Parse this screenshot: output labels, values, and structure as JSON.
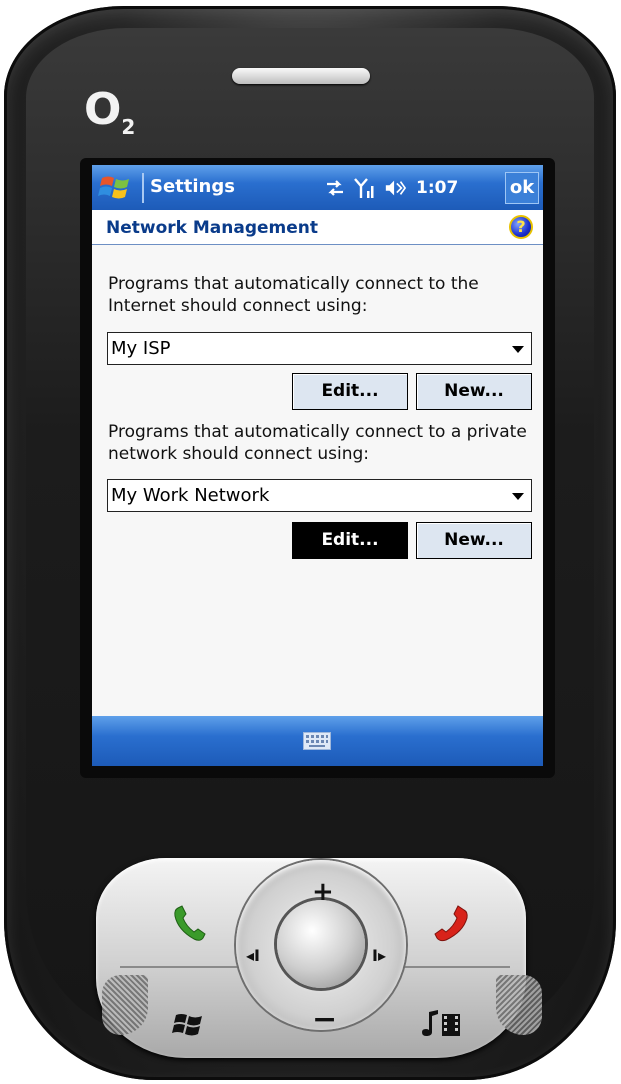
{
  "device": {
    "brand": "O",
    "brand_sub": "2"
  },
  "titlebar": {
    "title": "Settings",
    "clock": "1:07",
    "ok_label": "ok",
    "icons": [
      "sync-icon",
      "signal-icon",
      "volume-icon"
    ]
  },
  "page": {
    "title": "Network Management",
    "help_icon_label": "?"
  },
  "internet": {
    "description": "Programs that automatically connect to the Internet should connect using:",
    "selected": "My ISP",
    "edit_label": "Edit...",
    "new_label": "New..."
  },
  "private": {
    "description": "Programs that automatically connect to a private network should connect using:",
    "selected": "My Work Network",
    "edit_label": "Edit...",
    "new_label": "New..."
  },
  "keypad": {
    "plus_label": "+",
    "minus_label": "−",
    "left_label": "◂I",
    "right_label": "I▸"
  },
  "colors": {
    "titlebar_blue": "#2a6fcf",
    "header_text": "#0a3b8a",
    "call_green": "#3a9a2a",
    "end_red": "#d8231a"
  }
}
